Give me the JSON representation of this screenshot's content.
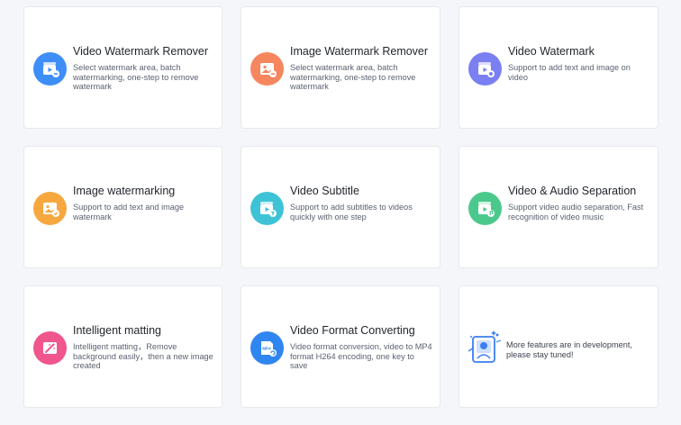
{
  "tools": [
    {
      "title": "Video Watermark Remover",
      "desc": "Select watermark area, batch watermarking, one-step to remove watermark",
      "icon": "video-eraser-icon",
      "color": "#3e8ef7"
    },
    {
      "title": "Image Watermark Remover",
      "desc": "Select watermark area, batch watermarking, one-step to remove watermark",
      "icon": "image-eraser-icon",
      "color": "#f5865e"
    },
    {
      "title": "Video Watermark",
      "desc": "Support to add text and image on video",
      "icon": "video-watermark-icon",
      "color": "#7a7ff2"
    },
    {
      "title": "Image watermarking",
      "desc": "Support to add text and image watermark",
      "icon": "image-watermark-icon",
      "color": "#f6a83f"
    },
    {
      "title": "Video Subtitle",
      "desc": "Support to add subtitles to videos quickly with one step",
      "icon": "video-subtitle-icon",
      "color": "#3ec3d6"
    },
    {
      "title": "Video & Audio Separation",
      "desc": "Support video audio separation, Fast recognition of video music",
      "icon": "audio-separation-icon",
      "color": "#4bc98c"
    },
    {
      "title": "Intelligent matting",
      "desc": "Intelligent matting，Remove background easily，then a new image created",
      "icon": "magic-wand-icon",
      "color": "#f0558e"
    },
    {
      "title": "Video Format Converting",
      "desc": "Video format conversion, video to MP4 format H264 encoding, one key to save",
      "icon": "mp4-convert-icon",
      "color": "#2f86f0",
      "badge": "MP4"
    }
  ],
  "more": {
    "text": "More features are in development, please stay tuned!",
    "icon": "in-development-icon"
  }
}
